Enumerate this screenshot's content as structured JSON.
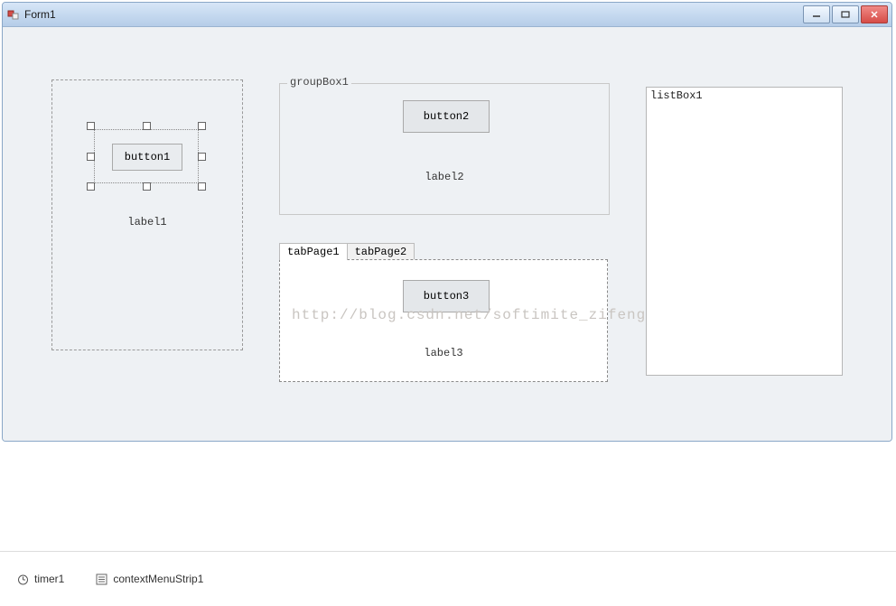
{
  "window": {
    "title": "Form1"
  },
  "panel": {
    "label1": "label1",
    "button1": "button1"
  },
  "groupbox": {
    "caption": "groupBox1",
    "button2": "button2",
    "label2": "label2"
  },
  "tabs": {
    "tab1": "tabPage1",
    "tab2": "tabPage2",
    "button3": "button3",
    "label3": "label3"
  },
  "listbox": {
    "item0": "listBox1"
  },
  "watermark": "http://blog.csdn.net/softimite_zifeng",
  "tray": {
    "timer": "timer1",
    "contextmenu": "contextMenuStrip1"
  }
}
